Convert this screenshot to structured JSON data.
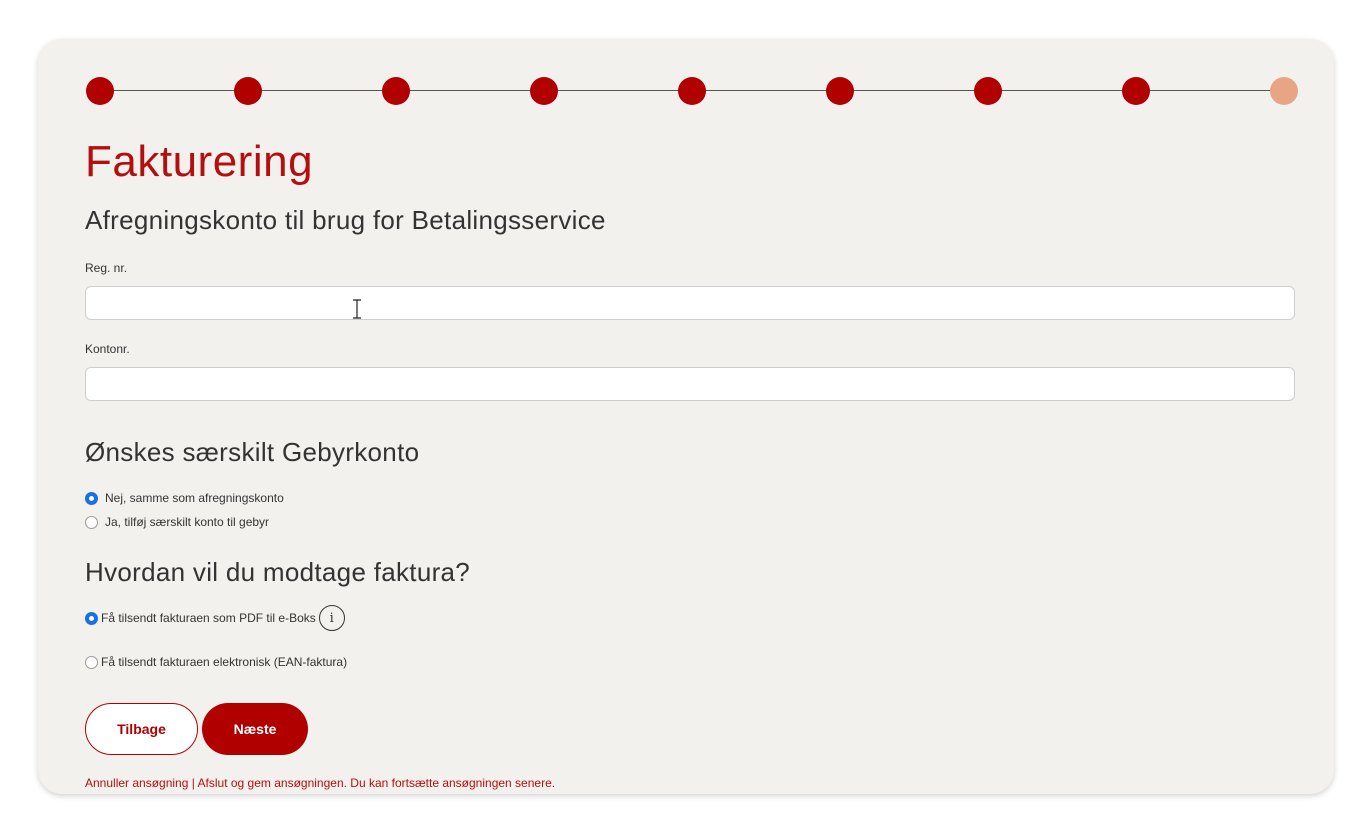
{
  "stepper": {
    "total_steps": 9,
    "current_step": 9,
    "completed_color": "#b00000",
    "current_color": "#e8a584"
  },
  "page_title": "Fakturering",
  "settlement_section": {
    "title": "Afregningskonto til brug for Betalingsservice",
    "reg_label": "Reg. nr.",
    "reg_value": "",
    "account_label": "Kontonr.",
    "account_value": ""
  },
  "fee_account_section": {
    "title": "Ønskes særskilt Gebyrkonto",
    "options": [
      {
        "label": "Nej, samme som afregningskonto",
        "checked": true
      },
      {
        "label": "Ja, tilføj særskilt konto til gebyr",
        "checked": false
      }
    ]
  },
  "invoice_section": {
    "title": "Hvordan vil du modtage faktura?",
    "options": [
      {
        "label": "Få tilsendt fakturaen som PDF til e-Boks",
        "checked": true,
        "info_icon": "info-icon"
      },
      {
        "label": "Få tilsendt fakturaen elektronisk (EAN-faktura)",
        "checked": false
      }
    ]
  },
  "buttons": {
    "back_label": "Tilbage",
    "next_label": "Næste"
  },
  "footer": {
    "cancel_label": "Annuller ansøgning",
    "separator": " | ",
    "save_label": "Afslut og gem ansøgningen. Du kan fortsætte ansøgningen senere."
  },
  "colors": {
    "accent": "#b00000",
    "title_red": "#b50e0e",
    "radio_blue": "#1a6fe6",
    "card_bg": "#f3f1ee"
  }
}
